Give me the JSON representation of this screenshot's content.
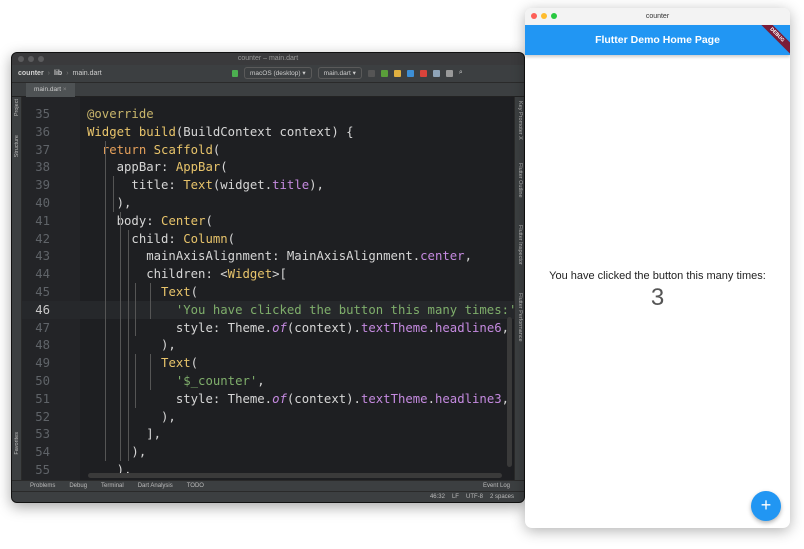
{
  "ide": {
    "title": "counter – main.dart",
    "breadcrumb": [
      "counter",
      "lib",
      "main.dart"
    ],
    "device": "macOS (desktop)",
    "run_config": "main.dart",
    "tab": "main.dart",
    "left_tools": [
      "Project",
      "Structure",
      "Favorites"
    ],
    "right_tools": [
      "Key Promoter X",
      "Flutter Outline",
      "Flutter Inspector",
      "Flutter Performance"
    ],
    "bottom_tools": [
      "Problems",
      "Debug",
      "Terminal",
      "Dart Analysis",
      "TODO"
    ],
    "event_log": "Event Log",
    "status": {
      "position": "46:32",
      "line_sep": "LF",
      "encoding": "UTF-8",
      "indent": "2 spaces"
    },
    "current_line": 46,
    "lines": [
      {
        "n": 35,
        "t": [
          [
            "an",
            "@override"
          ]
        ]
      },
      {
        "n": 36,
        "t": [
          [
            "ty",
            "Widget "
          ],
          [
            "fn",
            "build"
          ],
          [
            "",
            "(BuildContext context) {"
          ]
        ]
      },
      {
        "n": 37,
        "t": [
          [
            "",
            "  "
          ],
          [
            "kw",
            "return "
          ],
          [
            "ty",
            "Scaffold"
          ],
          [
            "",
            "("
          ]
        ]
      },
      {
        "n": 38,
        "t": [
          [
            "",
            "    appBar: "
          ],
          [
            "ty",
            "AppBar"
          ],
          [
            "",
            "("
          ]
        ]
      },
      {
        "n": 39,
        "t": [
          [
            "",
            "      title: "
          ],
          [
            "ty",
            "Text"
          ],
          [
            "",
            "(widget."
          ],
          [
            "pr",
            "title"
          ],
          [
            "",
            "),"
          ]
        ]
      },
      {
        "n": 40,
        "t": [
          [
            "",
            "    ),"
          ]
        ]
      },
      {
        "n": 41,
        "t": [
          [
            "",
            "    body: "
          ],
          [
            "ty",
            "Center"
          ],
          [
            "",
            "("
          ]
        ]
      },
      {
        "n": 42,
        "t": [
          [
            "",
            "      child: "
          ],
          [
            "ty",
            "Column"
          ],
          [
            "",
            "("
          ]
        ]
      },
      {
        "n": 43,
        "t": [
          [
            "",
            "        mainAxisAlignment: MainAxisAlignment."
          ],
          [
            "pr",
            "center"
          ],
          [
            "",
            ","
          ]
        ]
      },
      {
        "n": 44,
        "t": [
          [
            "",
            "        children: <"
          ],
          [
            "ty",
            "Widget"
          ],
          [
            "",
            ">["
          ]
        ]
      },
      {
        "n": 45,
        "t": [
          [
            "",
            "          "
          ],
          [
            "ty",
            "Text"
          ],
          [
            "",
            "("
          ]
        ]
      },
      {
        "n": 46,
        "t": [
          [
            "",
            "            "
          ],
          [
            "st",
            "'You have clicked the button this many times:'"
          ],
          [
            "",
            ","
          ]
        ]
      },
      {
        "n": 47,
        "t": [
          [
            "",
            "            style: Theme."
          ],
          [
            "it",
            "of"
          ],
          [
            "",
            "(context)."
          ],
          [
            "pr",
            "textTheme"
          ],
          [
            "",
            "."
          ],
          [
            "pr",
            "headline6"
          ],
          [
            "",
            ","
          ]
        ]
      },
      {
        "n": 48,
        "t": [
          [
            "",
            "          ),"
          ]
        ]
      },
      {
        "n": 49,
        "t": [
          [
            "",
            "          "
          ],
          [
            "ty",
            "Text"
          ],
          [
            "",
            "("
          ]
        ]
      },
      {
        "n": 50,
        "t": [
          [
            "",
            "            "
          ],
          [
            "st",
            "'$_counter'"
          ],
          [
            "",
            ","
          ]
        ]
      },
      {
        "n": 51,
        "t": [
          [
            "",
            "            style: Theme."
          ],
          [
            "it",
            "of"
          ],
          [
            "",
            "(context)."
          ],
          [
            "pr",
            "textTheme"
          ],
          [
            "",
            "."
          ],
          [
            "pr",
            "headline3"
          ],
          [
            "",
            ","
          ]
        ]
      },
      {
        "n": 52,
        "t": [
          [
            "",
            "          ),"
          ]
        ]
      },
      {
        "n": 53,
        "t": [
          [
            "",
            "        ],"
          ]
        ]
      },
      {
        "n": 54,
        "t": [
          [
            "",
            "      ),"
          ]
        ]
      },
      {
        "n": 55,
        "t": [
          [
            "",
            "    ),"
          ]
        ]
      }
    ]
  },
  "app": {
    "title": "counter",
    "appbar_title": "Flutter Demo Home Page",
    "debug_banner": "DEBUG",
    "message": "You have clicked the button this many times:",
    "counter": "3",
    "fab_icon": "add-icon",
    "fab_label": "+",
    "accent": "#2196f3"
  }
}
